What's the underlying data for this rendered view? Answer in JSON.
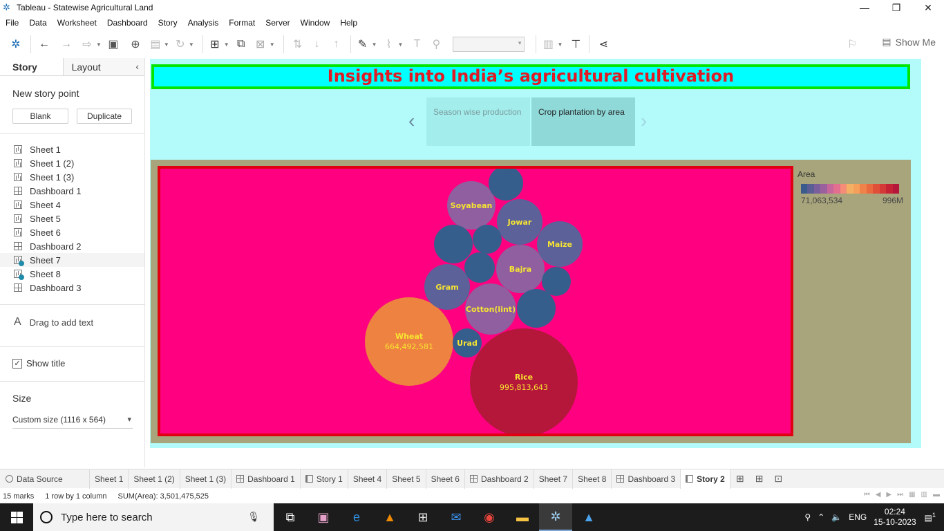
{
  "window": {
    "title": "Tableau - Statewise Agricultural Land",
    "controls": [
      "—",
      "❐",
      "✕"
    ]
  },
  "menu": [
    "File",
    "Data",
    "Worksheet",
    "Dashboard",
    "Story",
    "Analysis",
    "Format",
    "Server",
    "Window",
    "Help"
  ],
  "toolbar": {
    "show_me_label": "Show Me"
  },
  "left_pane": {
    "tabs": [
      "Story",
      "Layout"
    ],
    "new_story_point": "New story point",
    "blank_button": "Blank",
    "duplicate_button": "Duplicate",
    "sheets": [
      {
        "label": "Sheet 1",
        "type": "worksheet"
      },
      {
        "label": "Sheet 1 (2)",
        "type": "worksheet"
      },
      {
        "label": "Sheet 1 (3)",
        "type": "worksheet"
      },
      {
        "label": "Dashboard 1",
        "type": "dashboard"
      },
      {
        "label": "Sheet 4",
        "type": "worksheet"
      },
      {
        "label": "Sheet 5",
        "type": "worksheet"
      },
      {
        "label": "Sheet 6",
        "type": "worksheet"
      },
      {
        "label": "Dashboard 2",
        "type": "dashboard"
      },
      {
        "label": "Sheet 7",
        "type": "worksheet",
        "used": true
      },
      {
        "label": "Sheet 8",
        "type": "worksheet",
        "used": true
      },
      {
        "label": "Dashboard 3",
        "type": "dashboard"
      }
    ],
    "drag_text": "Drag to add text",
    "show_title": "Show title",
    "size_heading": "Size",
    "size_value": "Custom size (1116 x 564)"
  },
  "story": {
    "title": "Insights into India’s agricultural cultivation",
    "points": [
      {
        "label": "Season wise production",
        "active": false
      },
      {
        "label": "Crop plantation by area",
        "active": true
      }
    ]
  },
  "chart_data": {
    "type": "bubble",
    "measure": "Area",
    "bubbles": [
      {
        "label": "Rice",
        "value": 995813643,
        "value_label": "995,813,643",
        "color": "#b5173a"
      },
      {
        "label": "Wheat",
        "value": 664492581,
        "value_label": "664,492,581",
        "color": "#ee8240"
      },
      {
        "label": "Cotton(lint)",
        "color": "#8f5f9f"
      },
      {
        "label": "Bajra",
        "color": "#8f5f9f"
      },
      {
        "label": "Soyabean",
        "color": "#8f5f9f"
      },
      {
        "label": "Jowar",
        "color": "#5c6199"
      },
      {
        "label": "Maize",
        "color": "#5c6199"
      },
      {
        "label": "Gram",
        "color": "#5c6199"
      },
      {
        "label": "Urad",
        "color": "#365e8d"
      },
      {
        "label": "",
        "color": "#365e8d"
      },
      {
        "label": "",
        "color": "#365e8d"
      },
      {
        "label": "",
        "color": "#365e8d"
      },
      {
        "label": "",
        "color": "#365e8d"
      },
      {
        "label": "",
        "color": "#365e8d"
      },
      {
        "label": "",
        "color": "#365e8d"
      }
    ],
    "legend": {
      "title": "Area",
      "min_label": "71,063,534",
      "max_label": "996M",
      "colors": [
        "#3b5b8c",
        "#5b5d95",
        "#7a5f9c",
        "#9b619e",
        "#c6679b",
        "#e26f90",
        "#f48c78",
        "#f3b064",
        "#f5a05a",
        "#f08349",
        "#ea6a40",
        "#e05039",
        "#d43837",
        "#c52236",
        "#b5173a"
      ]
    }
  },
  "bottom_tabs": [
    {
      "label": "Data Source",
      "icon": "ds"
    },
    {
      "label": "Sheet 1",
      "icon": ""
    },
    {
      "label": "Sheet 1 (2)",
      "icon": ""
    },
    {
      "label": "Sheet 1 (3)",
      "icon": ""
    },
    {
      "label": "Dashboard 1",
      "icon": "db"
    },
    {
      "label": "Story 1",
      "icon": "st"
    },
    {
      "label": "Sheet 4",
      "icon": ""
    },
    {
      "label": "Sheet 5",
      "icon": ""
    },
    {
      "label": "Sheet 6",
      "icon": ""
    },
    {
      "label": "Dashboard 2",
      "icon": "db"
    },
    {
      "label": "Sheet 7",
      "icon": ""
    },
    {
      "label": "Sheet 8",
      "icon": ""
    },
    {
      "label": "Dashboard 3",
      "icon": "db"
    },
    {
      "label": "Story 2",
      "icon": "st",
      "active": true
    }
  ],
  "status": {
    "marks": "15 marks",
    "rows_cols": "1 row by 1 column",
    "sum": "SUM(Area): 3,501,475,525"
  },
  "taskbar": {
    "search_placeholder": "Type here to search",
    "language": "ENG",
    "time": "02:24",
    "date": "15-10-2023",
    "notification_count": "1"
  }
}
